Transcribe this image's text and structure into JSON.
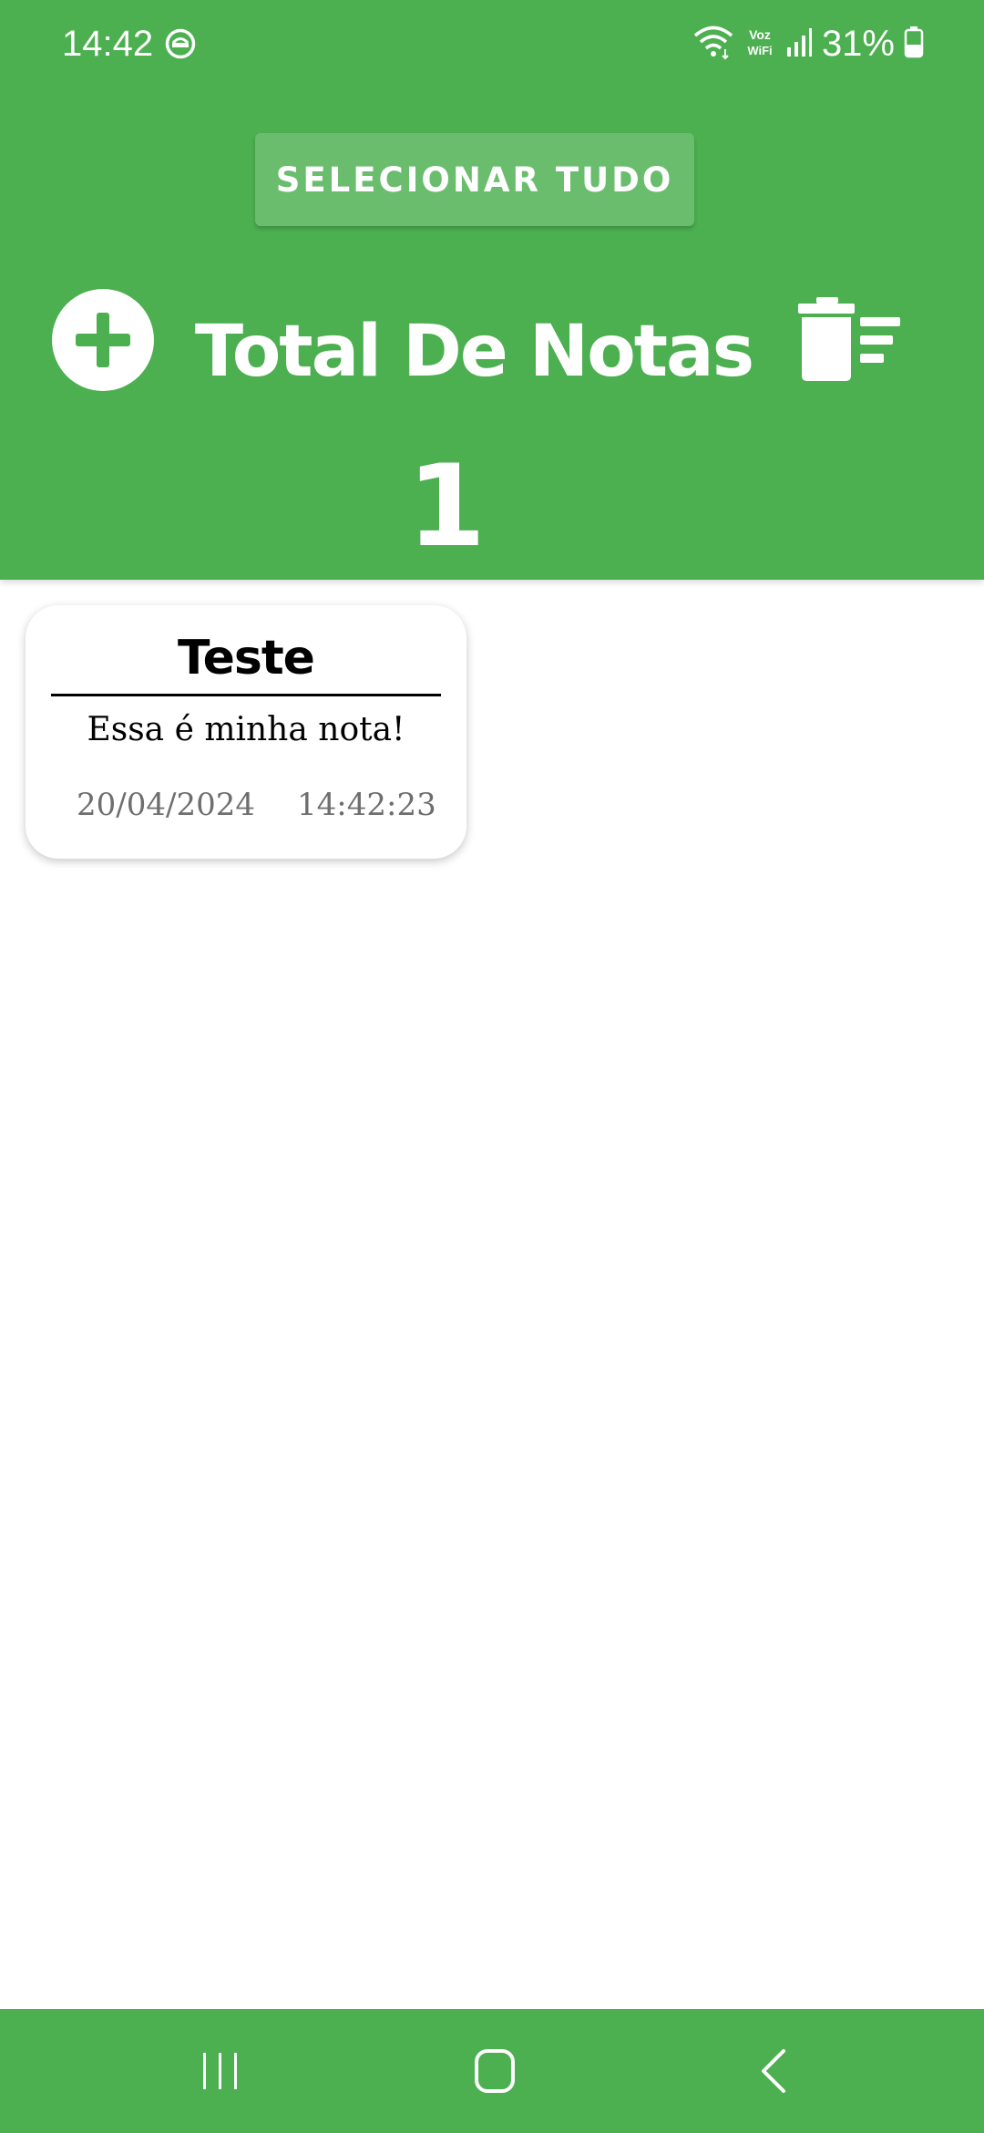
{
  "status_bar": {
    "time": "14:42",
    "battery_percent": "31%",
    "network_label": "Voz WiFi",
    "icons": [
      "do-not-disturb-icon",
      "wifi-icon",
      "voz-wifi-icon",
      "signal-icon",
      "battery-icon"
    ]
  },
  "header": {
    "select_all_label": "SELECIONAR TUDO",
    "title": "Total De Notas",
    "total_count": "1",
    "add_icon": "plus-circle-icon",
    "delete_icon": "trash-list-icon"
  },
  "notes": [
    {
      "title": "Teste",
      "body": "Essa é minha nota!",
      "date": "20/04/2024",
      "time": "14:42:23"
    }
  ],
  "nav_bar": {
    "icons": [
      "recent-apps-icon",
      "home-icon",
      "back-icon"
    ]
  },
  "colors": {
    "primary": "#4caf50",
    "button": "#6abd6d",
    "surface": "#ffffff",
    "muted_text": "#6e6e6e"
  }
}
